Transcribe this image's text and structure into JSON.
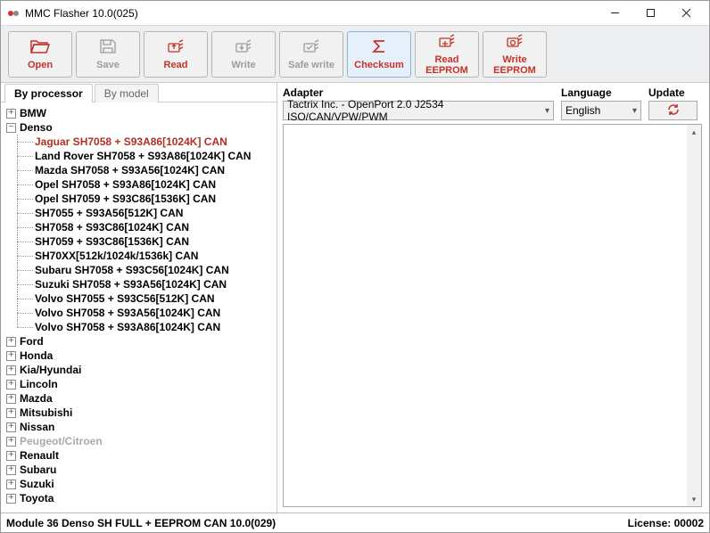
{
  "window": {
    "title": "MMC Flasher 10.0(025)"
  },
  "toolbar": {
    "open": "Open",
    "save": "Save",
    "read": "Read",
    "write": "Write",
    "safewrite": "Safe write",
    "checksum": "Checksum",
    "readeeprom": "Read EEPROM",
    "writeeeprom": "Write\nEEPROM"
  },
  "tabs": {
    "byproc": "By processor",
    "bymodel": "By model"
  },
  "tree": {
    "top": [
      {
        "label": "BMW",
        "exp": "+"
      },
      {
        "label": "Denso",
        "exp": "-",
        "children": [
          {
            "label": "Jaguar SH7058 + S93A86[1024K] CAN",
            "sel": true
          },
          {
            "label": "Land Rover SH7058 + S93A86[1024K] CAN"
          },
          {
            "label": "Mazda SH7058 + S93A56[1024K] CAN"
          },
          {
            "label": "Opel SH7058 + S93A86[1024K] CAN"
          },
          {
            "label": "Opel SH7059 + S93C86[1536K] CAN"
          },
          {
            "label": "SH7055 + S93A56[512K] CAN"
          },
          {
            "label": "SH7058 + S93C86[1024K] CAN"
          },
          {
            "label": "SH7059 + S93C86[1536K] CAN"
          },
          {
            "label": "SH70XX[512k/1024k/1536k] CAN"
          },
          {
            "label": "Subaru SH7058 + S93C56[1024K] CAN"
          },
          {
            "label": "Suzuki SH7058 + S93A56[1024K] CAN"
          },
          {
            "label": "Volvo SH7055 + S93C56[512K] CAN"
          },
          {
            "label": "Volvo SH7058 + S93A56[1024K] CAN"
          },
          {
            "label": "Volvo SH7058 + S93A86[1024K] CAN"
          }
        ]
      },
      {
        "label": "Ford",
        "exp": "+"
      },
      {
        "label": "Honda",
        "exp": "+"
      },
      {
        "label": "Kia/Hyundai",
        "exp": "+"
      },
      {
        "label": "Lincoln",
        "exp": "+"
      },
      {
        "label": "Mazda",
        "exp": "+"
      },
      {
        "label": "Mitsubishi",
        "exp": "+"
      },
      {
        "label": "Nissan",
        "exp": "+"
      },
      {
        "label": "Peugeot/Citroen",
        "exp": "+",
        "dim": true
      },
      {
        "label": "Renault",
        "exp": "+"
      },
      {
        "label": "Subaru",
        "exp": "+"
      },
      {
        "label": "Suzuki",
        "exp": "+"
      },
      {
        "label": "Toyota",
        "exp": "+"
      }
    ]
  },
  "right": {
    "adapter_label": "Adapter",
    "adapter_value": "Tactrix Inc. - OpenPort 2.0 J2534 ISO/CAN/VPW/PWM",
    "language_label": "Language",
    "language_value": "English",
    "update_label": "Update"
  },
  "status": {
    "left": "Module 36 Denso SH FULL + EEPROM CAN 10.0(029)",
    "right": "License: 00002"
  },
  "icons": {
    "open_color": "#c3332b",
    "disabled_color": "#9c9c9c"
  }
}
